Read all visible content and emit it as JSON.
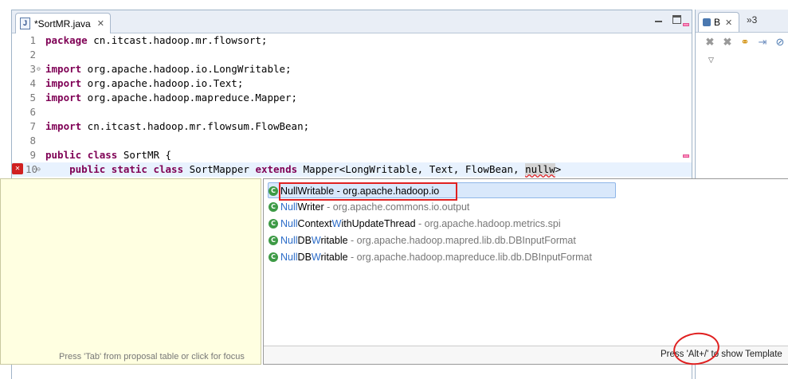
{
  "editor": {
    "tab_title": "*SortMR.java",
    "tab_icon": "java-file-icon",
    "lines": [
      {
        "num": "1",
        "tokens": [
          {
            "t": "package",
            "c": "kw"
          },
          {
            "t": " cn.itcast.hadoop.mr.flowsort;"
          }
        ]
      },
      {
        "num": "2",
        "tokens": []
      },
      {
        "num": "3",
        "tokens": [
          {
            "t": "import",
            "c": "kw"
          },
          {
            "t": " org.apache.hadoop.io.LongWritable;"
          }
        ],
        "fold": true
      },
      {
        "num": "4",
        "tokens": [
          {
            "t": "import",
            "c": "kw"
          },
          {
            "t": " org.apache.hadoop.io.Text;"
          }
        ]
      },
      {
        "num": "5",
        "tokens": [
          {
            "t": "import",
            "c": "kw"
          },
          {
            "t": " org.apache.hadoop.mapreduce.Mapper;"
          }
        ]
      },
      {
        "num": "6",
        "tokens": []
      },
      {
        "num": "7",
        "tokens": [
          {
            "t": "import",
            "c": "kw"
          },
          {
            "t": " cn.itcast.hadoop.mr.flowsum.FlowBean;"
          }
        ]
      },
      {
        "num": "8",
        "tokens": []
      },
      {
        "num": "9",
        "tokens": [
          {
            "t": "public",
            "c": "kw"
          },
          {
            "t": " "
          },
          {
            "t": "class",
            "c": "kw"
          },
          {
            "t": " SortMR {"
          }
        ]
      },
      {
        "num": "10",
        "tokens": [
          {
            "t": "    "
          },
          {
            "t": "public",
            "c": "kw"
          },
          {
            "t": " "
          },
          {
            "t": "static",
            "c": "kw"
          },
          {
            "t": " "
          },
          {
            "t": "class",
            "c": "kw"
          },
          {
            "t": " SortMapper "
          },
          {
            "t": "extends",
            "c": "kw"
          },
          {
            "t": " Mapper<LongWritable, Text, FlowBean, "
          },
          {
            "t": "nullw",
            "c": "hl sq"
          },
          {
            "t": ">"
          }
        ],
        "fold": true,
        "current": true,
        "error": true
      }
    ]
  },
  "right_view": {
    "tab_label": "B",
    "more_tabs": "»3"
  },
  "content_assist": {
    "proposals": [
      {
        "parts": [
          {
            "t": "NullWritable",
            "c": ""
          }
        ],
        "pkg": " - org.apache.hadoop.io",
        "selected": true
      },
      {
        "parts": [
          {
            "t": "Null",
            "c": "m"
          },
          {
            "t": "Writer",
            "c": ""
          }
        ],
        "pkg": " - org.apache.commons.io.output"
      },
      {
        "parts": [
          {
            "t": "Null",
            "c": "m"
          },
          {
            "t": "Context",
            "c": ""
          },
          {
            "t": "W",
            "c": "m"
          },
          {
            "t": "ithUpdateThread",
            "c": ""
          }
        ],
        "pkg": " - org.apache.hadoop.metrics.spi"
      },
      {
        "parts": [
          {
            "t": "Null",
            "c": "m"
          },
          {
            "t": "DB",
            "c": ""
          },
          {
            "t": "W",
            "c": "m"
          },
          {
            "t": "ritable",
            "c": ""
          }
        ],
        "pkg": " - org.apache.hadoop.mapred.lib.db.DBInputFormat"
      },
      {
        "parts": [
          {
            "t": "Null",
            "c": "m"
          },
          {
            "t": "DB",
            "c": ""
          },
          {
            "t": "W",
            "c": "m"
          },
          {
            "t": "ritable",
            "c": ""
          }
        ],
        "pkg": " - org.apache.hadoop.mapreduce.lib.db.DBInputFormat"
      }
    ],
    "status_text": "Press 'Alt+/' to show Template",
    "doc_hint": "Press 'Tab' from proposal table or click for focus"
  },
  "colors": {
    "keyword": "#7f0055",
    "highlight_box": "#e02020",
    "current_line": "#e8f2fe",
    "doc_background": "#ffffe1"
  }
}
